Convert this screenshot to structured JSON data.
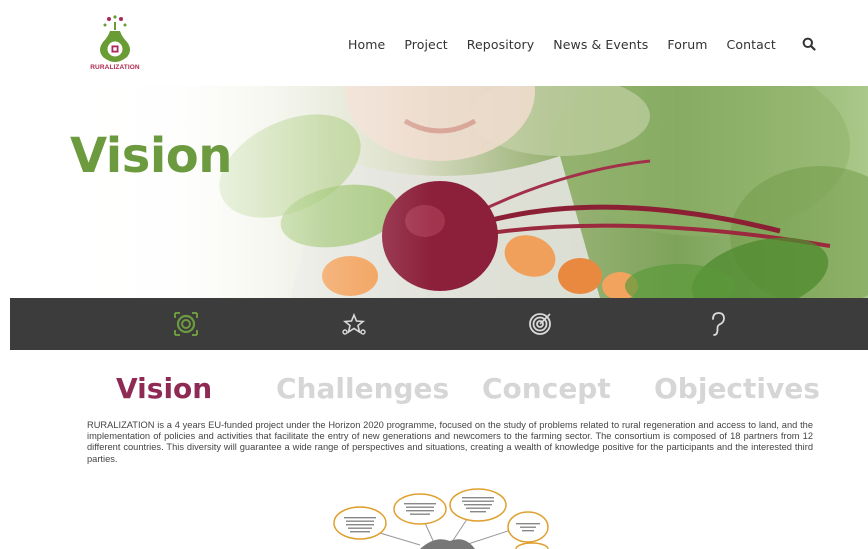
{
  "logo": {
    "text": "RURALIZATION",
    "colors": {
      "green": "#6a9c35",
      "purple": "#a8295a"
    }
  },
  "nav": {
    "items": [
      "Home",
      "Project",
      "Repository",
      "News & Events",
      "Forum",
      "Contact"
    ],
    "search_icon": "search-icon"
  },
  "hero": {
    "title": "Vision"
  },
  "icon_band": {
    "icons": [
      "vision-target-icon",
      "stars-icon",
      "target-icon",
      "question-icon"
    ],
    "active_color": "#6c9a3e",
    "inactive_color": "#d9d9d9"
  },
  "tabs": [
    {
      "label": "Vision",
      "active": true
    },
    {
      "label": "Challenges",
      "active": false
    },
    {
      "label": "Concept",
      "active": false
    },
    {
      "label": "Objectives",
      "active": false
    }
  ],
  "content": {
    "paragraph": "RURALIZATION is a 4 years EU-funded project under the Horizon 2020 programme, focused on the study of problems related to rural regeneration and access to land, and the implementation of policies and activities that facilitate the entry of new generations and newcomers to the farming sector. The consortium is composed of 18 partners from 12 different countries. This diversity will guarantee a wide range of perspectives and situations, creating a wealth of knowledge positive for the participants and the interested third parties."
  },
  "theme": {
    "active_tab": "#8f2a55",
    "inactive_tab": "#d6d6d6",
    "band_bg": "#3c3c3c",
    "hero_title": "#6c9a3e"
  }
}
